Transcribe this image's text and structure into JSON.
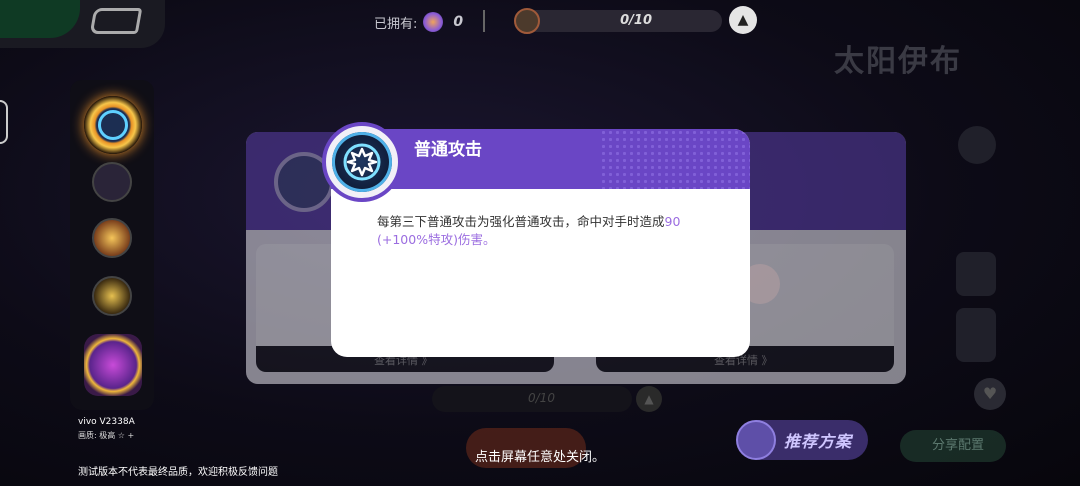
{
  "top_bar": {
    "owned_label": "已拥有:",
    "owned_count": "0",
    "progress_text": "0/10",
    "up_icon": "arrow-up-icon"
  },
  "pokemon": {
    "name": "太阳伊布"
  },
  "device": {
    "model": "vivo V2338A",
    "quality": "画质: 极高 ☆ +",
    "beta_notice": "测试版本不代表最终品质，欢迎积极反馈问题"
  },
  "background_panel": {
    "detail_a": "查看详情 》",
    "detail_b": "查看详情 》",
    "bottom_progress": "0/10"
  },
  "recommend_button": {
    "label": "推荐方案"
  },
  "share_button": {
    "label": "分享配置"
  },
  "popup": {
    "title": "普通攻击",
    "description_prefix": "每第三下普通攻击为强化普通攻击，命中对手时造成",
    "description_highlight": "90 (+100%特攻)",
    "description_suffix": "伤害。",
    "icon": "gear-star-icon"
  },
  "dismiss_hint": "点击屏幕任意处关闭。",
  "colors": {
    "popup_header": "#6a46c5",
    "highlight": "#9b6de0"
  }
}
